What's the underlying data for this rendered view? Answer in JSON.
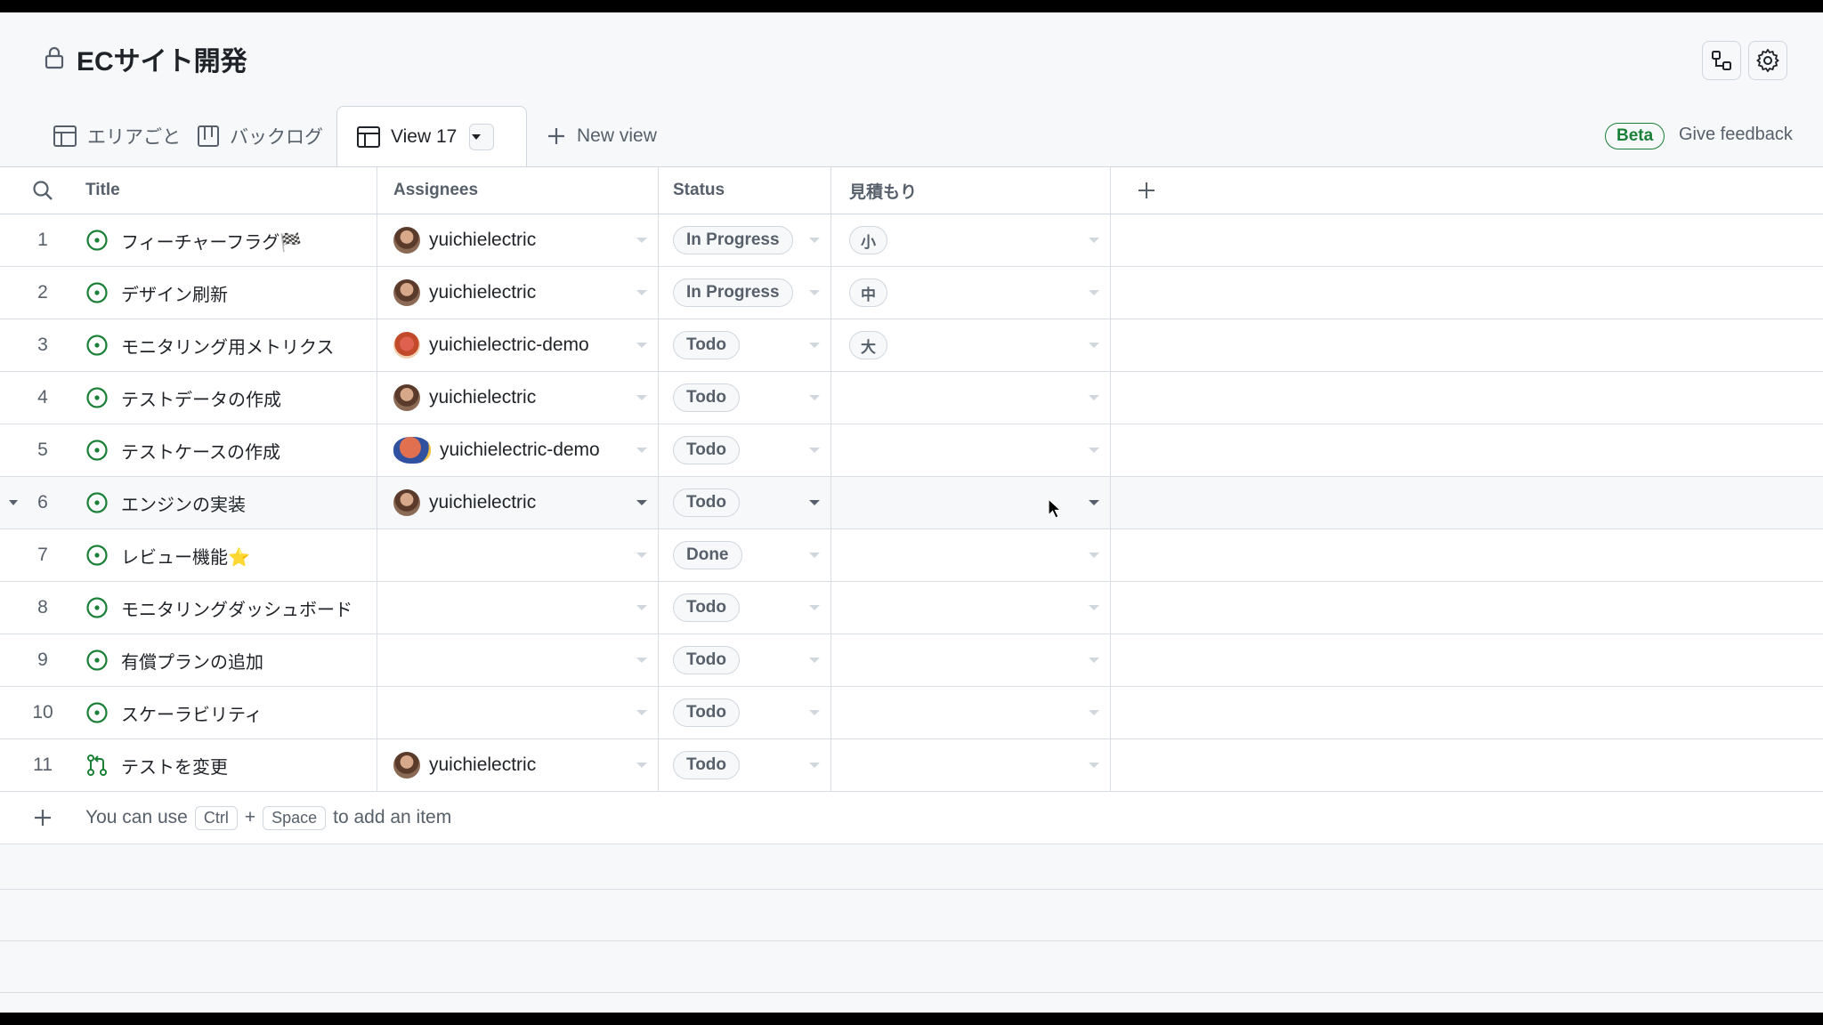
{
  "project": {
    "title": "ECサイト開発"
  },
  "tabs": [
    {
      "label": "エリアごと",
      "icon": "table-icon"
    },
    {
      "label": "バックログ",
      "icon": "board-icon"
    },
    {
      "label": "View 17",
      "icon": "table-icon",
      "active": true
    }
  ],
  "new_view_label": "New view",
  "beta_label": "Beta",
  "feedback_label": "Give feedback",
  "columns": {
    "title": "Title",
    "assignees": "Assignees",
    "status": "Status",
    "estimate": "見積もり"
  },
  "rows": [
    {
      "num": "1",
      "title": "フィーチャーフラグ🏁",
      "assignee": "yuichielectric",
      "avatar": "a1",
      "status": "In Progress",
      "estimate": "小",
      "type": "issue"
    },
    {
      "num": "2",
      "title": "デザイン刷新",
      "assignee": "yuichielectric",
      "avatar": "a1",
      "status": "In Progress",
      "estimate": "中",
      "type": "issue"
    },
    {
      "num": "3",
      "title": "モニタリング用メトリクス",
      "assignee": "yuichielectric-demo",
      "avatar": "a2",
      "status": "Todo",
      "estimate": "大",
      "type": "issue"
    },
    {
      "num": "4",
      "title": "テストデータの作成",
      "assignee": "yuichielectric",
      "avatar": "a1",
      "status": "Todo",
      "estimate": "",
      "type": "issue"
    },
    {
      "num": "5",
      "title": "テストケースの作成",
      "assignee": "yuichielectric-demo",
      "avatar": "a3",
      "status": "Todo",
      "estimate": "",
      "type": "issue"
    },
    {
      "num": "6",
      "title": "エンジンの実装",
      "assignee": "yuichielectric",
      "avatar": "a1",
      "status": "Todo",
      "estimate": "",
      "type": "issue",
      "hover": true
    },
    {
      "num": "7",
      "title": "レビュー機能⭐",
      "assignee": "",
      "avatar": "",
      "status": "Done",
      "estimate": "",
      "type": "issue"
    },
    {
      "num": "8",
      "title": "モニタリングダッシュボード",
      "assignee": "",
      "avatar": "",
      "status": "Todo",
      "estimate": "",
      "type": "issue"
    },
    {
      "num": "9",
      "title": "有償プランの追加",
      "assignee": "",
      "avatar": "",
      "status": "Todo",
      "estimate": "",
      "type": "issue"
    },
    {
      "num": "10",
      "title": "スケーラビリティ",
      "assignee": "",
      "avatar": "",
      "status": "Todo",
      "estimate": "",
      "type": "issue"
    },
    {
      "num": "11",
      "title": "テストを変更",
      "assignee": "yuichielectric",
      "avatar": "a1",
      "status": "Todo",
      "estimate": "",
      "type": "pull-request"
    }
  ],
  "add_hint": {
    "prefix": "You can use",
    "key1": "Ctrl",
    "plus": "+",
    "key2": "Space",
    "suffix": "to add an item"
  },
  "colors": {
    "open_issue": "#1a7f37",
    "beta": "#1a7f37",
    "border": "#d0d7de"
  }
}
